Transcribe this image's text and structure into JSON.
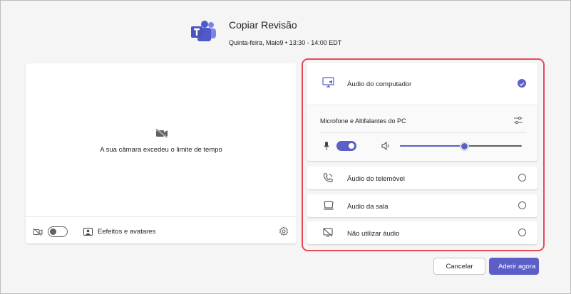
{
  "meeting": {
    "title": "Copiar Revisão",
    "subtitle": "Quinta-feira, Maio9 • 13:30 - 14:00 EDT"
  },
  "preview": {
    "camera_message": "A sua câmara excedeu o limite de tempo",
    "effects_label": "Eefeitos e avatares",
    "camera_toggle_on": false
  },
  "audio_options": {
    "computer": {
      "label": "Áudio do computador",
      "selected": true,
      "icon": "computer-audio-icon"
    },
    "device_settings": {
      "label": "Microfone e Altifalantes do PC",
      "mic_on": true,
      "speaker_volume": 0.53
    },
    "phone": {
      "label": "Áudio do telemóvel",
      "selected": false,
      "icon": "phone-audio-icon"
    },
    "room": {
      "label": "Áudio da sala",
      "selected": false,
      "icon": "room-audio-icon"
    },
    "none": {
      "label": "Não utilizar áudio",
      "selected": false,
      "icon": "no-audio-icon"
    }
  },
  "actions": {
    "cancel_label": "Cancelar",
    "join_label": "Aderir agora"
  },
  "colors": {
    "accent": "#5b5fc7",
    "highlight_outline": "#e8485a"
  }
}
